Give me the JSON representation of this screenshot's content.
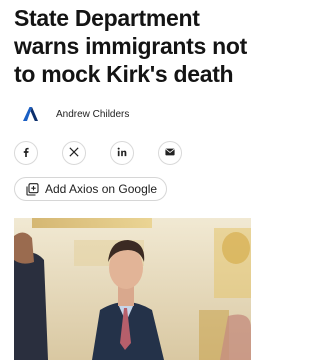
{
  "article": {
    "headline": "State Department warns immigrants not to mock Kirk's death",
    "author": "Andrew Childers"
  },
  "share": {
    "facebook_icon": "facebook-icon",
    "x_icon": "x-icon",
    "linkedin_icon": "linkedin-icon",
    "email_icon": "email-icon"
  },
  "cta": {
    "add_axios_label": "Add Axios on Google",
    "icon": "add-source-icon"
  },
  "colors": {
    "axios_logo": "#1a5fc4",
    "text": "#141414",
    "border": "#d9d9d9"
  }
}
